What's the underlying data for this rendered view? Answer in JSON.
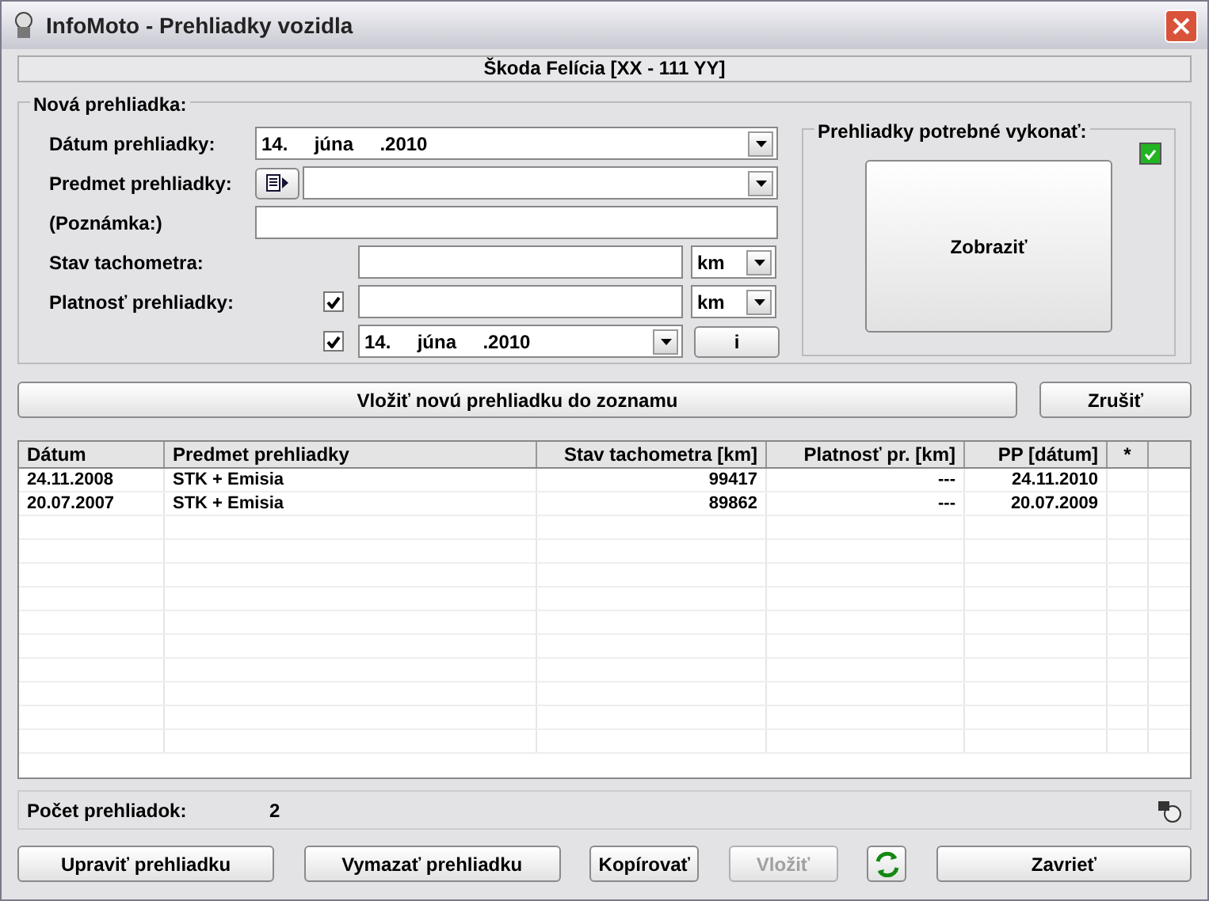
{
  "window": {
    "title": "InfoMoto - Prehliadky vozidla"
  },
  "vehicle": "Škoda Felícia [XX - 111 YY]",
  "new_inspection": {
    "legend": "Nová prehliadka:",
    "date": {
      "label": "Dátum prehliadky:",
      "value": "14.     júna     .2010"
    },
    "subject": {
      "label": "Predmet prehliadky:"
    },
    "note": {
      "label": "(Poznámka:)"
    },
    "odometer": {
      "label": "Stav tachometra:",
      "unit": "km"
    },
    "validity": {
      "label": "Platnosť prehliadky:",
      "km_checked": true,
      "unit": "km",
      "date_checked": true,
      "date": "14.     júna     .2010",
      "info_button": "i"
    }
  },
  "required": {
    "legend": "Prehliadky potrebné vykonať:",
    "indicator_checked": true,
    "button": "Zobraziť"
  },
  "insert_button": "Vložiť novú prehliadku do zoznamu",
  "cancel_button": "Zrušiť",
  "table": {
    "columns": [
      "Dátum",
      "Predmet prehliadky",
      "Stav tachometra [km]",
      "Platnosť pr. [km]",
      "PP [dátum]",
      "*"
    ],
    "rows": [
      [
        "24.11.2008",
        "STK + Emisia",
        "99417",
        "---",
        "24.11.2010",
        ""
      ],
      [
        "20.07.2007",
        "STK + Emisia",
        "89862",
        "---",
        "20.07.2009",
        ""
      ]
    ]
  },
  "status": {
    "label": "Počet prehliadok:",
    "value": "2"
  },
  "buttons": [
    {
      "kind": "text",
      "label": "Upraviť prehliadku",
      "disabled": false
    },
    {
      "kind": "text",
      "label": "Vymazať prehliadku",
      "disabled": false
    },
    {
      "kind": "text",
      "label": "Kopírovať",
      "disabled": false
    },
    {
      "kind": "text",
      "label": "Vložiť",
      "disabled": true
    },
    {
      "kind": "icon",
      "disabled": false
    },
    {
      "kind": "text",
      "label": "Zavrieť",
      "disabled": false
    }
  ]
}
